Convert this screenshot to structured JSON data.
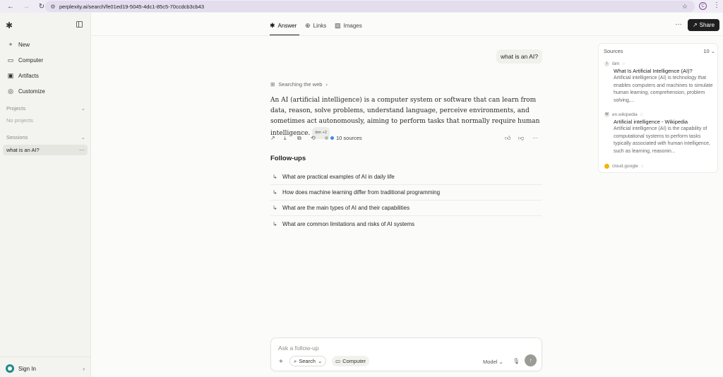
{
  "browser": {
    "url": "perplexity.ai/search/fe01ed19-5045-4dc1-85c5-70ccdcb3cb43",
    "account_letter": "C"
  },
  "sidebar": {
    "items": [
      {
        "label": "New",
        "icon": "plus-icon"
      },
      {
        "label": "Computer",
        "icon": "monitor-icon"
      },
      {
        "label": "Artifacts",
        "icon": "artifacts-icon"
      },
      {
        "label": "Customize",
        "icon": "customize-icon"
      }
    ],
    "projects_label": "Projects",
    "projects_empty": "No projects",
    "sessions_label": "Sessions",
    "session_item": "what is an AI?",
    "signin_label": "Sign In"
  },
  "header": {
    "tabs": [
      {
        "label": "Answer",
        "icon": "answer-icon"
      },
      {
        "label": "Links",
        "icon": "globe-icon"
      },
      {
        "label": "Images",
        "icon": "image-icon"
      }
    ],
    "share_label": "Share"
  },
  "chat": {
    "query": "what is an AI?",
    "status": "Searching the web",
    "answer": "An AI (artificial intelligence) is a computer system or software that can learn from data, reason, solve problems, understand language, perceive environments, and sometimes act autonomously, aiming to perform tasks that normally require human intelligence.",
    "citation": "ibm +2",
    "sources_count": "10 sources",
    "followups_title": "Follow-ups",
    "followups": [
      "What are practical examples of AI in daily life",
      "How does machine learning differ from traditional programming",
      "What are the main types of AI and their capabilities",
      "What are common limitations and risks of AI systems"
    ]
  },
  "sources_panel": {
    "title": "Sources",
    "count": "10",
    "items": [
      {
        "domain": "ibm",
        "title": "What Is Artificial Intelligence (AI)?",
        "snippet": "Artificial intelligence (AI) is technology that enables computers and machines to simulate human learning, comprehension, problem solving,..."
      },
      {
        "domain": "en.wikipedia",
        "title": "Artificial intelligence - Wikipedia",
        "snippet": "Artificial intelligence (AI) is the capability of computational systems to perform tasks typically associated with human intelligence, such as learning, reasonin..."
      },
      {
        "domain": "cloud.google",
        "title": "",
        "snippet": ""
      }
    ]
  },
  "input": {
    "placeholder": "Ask a follow-up",
    "search_label": "Search",
    "computer_label": "Computer",
    "model_label": "Model"
  }
}
